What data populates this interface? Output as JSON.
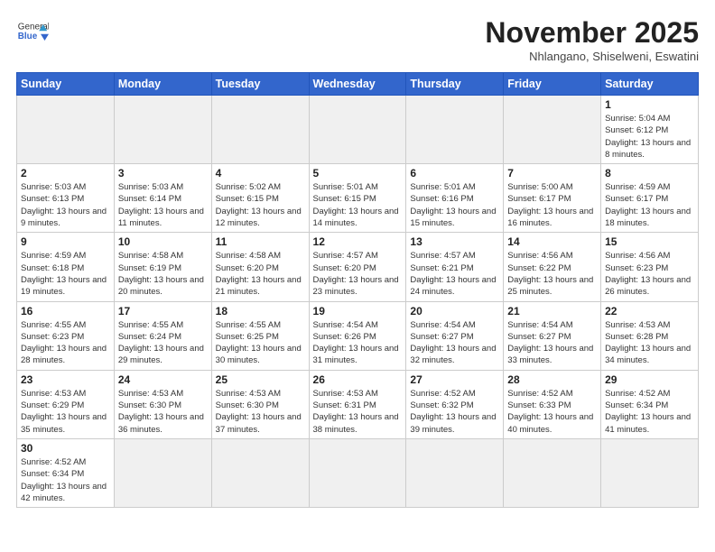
{
  "header": {
    "logo_general": "General",
    "logo_blue": "Blue",
    "month_title": "November 2025",
    "subtitle": "Nhlangano, Shiselweni, Eswatini"
  },
  "weekdays": [
    "Sunday",
    "Monday",
    "Tuesday",
    "Wednesday",
    "Thursday",
    "Friday",
    "Saturday"
  ],
  "weeks": [
    [
      {
        "day": "",
        "info": ""
      },
      {
        "day": "",
        "info": ""
      },
      {
        "day": "",
        "info": ""
      },
      {
        "day": "",
        "info": ""
      },
      {
        "day": "",
        "info": ""
      },
      {
        "day": "",
        "info": ""
      },
      {
        "day": "1",
        "info": "Sunrise: 5:04 AM\nSunset: 6:12 PM\nDaylight: 13 hours and 8 minutes."
      }
    ],
    [
      {
        "day": "2",
        "info": "Sunrise: 5:03 AM\nSunset: 6:13 PM\nDaylight: 13 hours and 9 minutes."
      },
      {
        "day": "3",
        "info": "Sunrise: 5:03 AM\nSunset: 6:14 PM\nDaylight: 13 hours and 11 minutes."
      },
      {
        "day": "4",
        "info": "Sunrise: 5:02 AM\nSunset: 6:15 PM\nDaylight: 13 hours and 12 minutes."
      },
      {
        "day": "5",
        "info": "Sunrise: 5:01 AM\nSunset: 6:15 PM\nDaylight: 13 hours and 14 minutes."
      },
      {
        "day": "6",
        "info": "Sunrise: 5:01 AM\nSunset: 6:16 PM\nDaylight: 13 hours and 15 minutes."
      },
      {
        "day": "7",
        "info": "Sunrise: 5:00 AM\nSunset: 6:17 PM\nDaylight: 13 hours and 16 minutes."
      },
      {
        "day": "8",
        "info": "Sunrise: 4:59 AM\nSunset: 6:17 PM\nDaylight: 13 hours and 18 minutes."
      }
    ],
    [
      {
        "day": "9",
        "info": "Sunrise: 4:59 AM\nSunset: 6:18 PM\nDaylight: 13 hours and 19 minutes."
      },
      {
        "day": "10",
        "info": "Sunrise: 4:58 AM\nSunset: 6:19 PM\nDaylight: 13 hours and 20 minutes."
      },
      {
        "day": "11",
        "info": "Sunrise: 4:58 AM\nSunset: 6:20 PM\nDaylight: 13 hours and 21 minutes."
      },
      {
        "day": "12",
        "info": "Sunrise: 4:57 AM\nSunset: 6:20 PM\nDaylight: 13 hours and 23 minutes."
      },
      {
        "day": "13",
        "info": "Sunrise: 4:57 AM\nSunset: 6:21 PM\nDaylight: 13 hours and 24 minutes."
      },
      {
        "day": "14",
        "info": "Sunrise: 4:56 AM\nSunset: 6:22 PM\nDaylight: 13 hours and 25 minutes."
      },
      {
        "day": "15",
        "info": "Sunrise: 4:56 AM\nSunset: 6:23 PM\nDaylight: 13 hours and 26 minutes."
      }
    ],
    [
      {
        "day": "16",
        "info": "Sunrise: 4:55 AM\nSunset: 6:23 PM\nDaylight: 13 hours and 28 minutes."
      },
      {
        "day": "17",
        "info": "Sunrise: 4:55 AM\nSunset: 6:24 PM\nDaylight: 13 hours and 29 minutes."
      },
      {
        "day": "18",
        "info": "Sunrise: 4:55 AM\nSunset: 6:25 PM\nDaylight: 13 hours and 30 minutes."
      },
      {
        "day": "19",
        "info": "Sunrise: 4:54 AM\nSunset: 6:26 PM\nDaylight: 13 hours and 31 minutes."
      },
      {
        "day": "20",
        "info": "Sunrise: 4:54 AM\nSunset: 6:27 PM\nDaylight: 13 hours and 32 minutes."
      },
      {
        "day": "21",
        "info": "Sunrise: 4:54 AM\nSunset: 6:27 PM\nDaylight: 13 hours and 33 minutes."
      },
      {
        "day": "22",
        "info": "Sunrise: 4:53 AM\nSunset: 6:28 PM\nDaylight: 13 hours and 34 minutes."
      }
    ],
    [
      {
        "day": "23",
        "info": "Sunrise: 4:53 AM\nSunset: 6:29 PM\nDaylight: 13 hours and 35 minutes."
      },
      {
        "day": "24",
        "info": "Sunrise: 4:53 AM\nSunset: 6:30 PM\nDaylight: 13 hours and 36 minutes."
      },
      {
        "day": "25",
        "info": "Sunrise: 4:53 AM\nSunset: 6:30 PM\nDaylight: 13 hours and 37 minutes."
      },
      {
        "day": "26",
        "info": "Sunrise: 4:53 AM\nSunset: 6:31 PM\nDaylight: 13 hours and 38 minutes."
      },
      {
        "day": "27",
        "info": "Sunrise: 4:52 AM\nSunset: 6:32 PM\nDaylight: 13 hours and 39 minutes."
      },
      {
        "day": "28",
        "info": "Sunrise: 4:52 AM\nSunset: 6:33 PM\nDaylight: 13 hours and 40 minutes."
      },
      {
        "day": "29",
        "info": "Sunrise: 4:52 AM\nSunset: 6:34 PM\nDaylight: 13 hours and 41 minutes."
      }
    ],
    [
      {
        "day": "30",
        "info": "Sunrise: 4:52 AM\nSunset: 6:34 PM\nDaylight: 13 hours and 42 minutes."
      },
      {
        "day": "",
        "info": ""
      },
      {
        "day": "",
        "info": ""
      },
      {
        "day": "",
        "info": ""
      },
      {
        "day": "",
        "info": ""
      },
      {
        "day": "",
        "info": ""
      },
      {
        "day": "",
        "info": ""
      }
    ]
  ]
}
